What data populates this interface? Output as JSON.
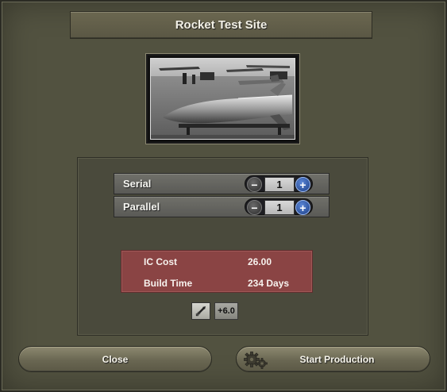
{
  "window": {
    "title": "Rocket Test Site"
  },
  "image": {
    "subject": "rocket-test-site-photo"
  },
  "production": {
    "rows": [
      {
        "label": "Serial",
        "value": "1"
      },
      {
        "label": "Parallel",
        "value": "1"
      }
    ],
    "minus_symbol": "−",
    "plus_symbol": "+"
  },
  "cost": {
    "ic_cost_label": "IC Cost",
    "ic_cost_value": "26.00",
    "build_time_label": "Build Time",
    "build_time_value": "234 Days"
  },
  "modifiers": {
    "tech_icon": "rocket-icon",
    "bonus": "+6.0"
  },
  "buttons": {
    "close": "Close",
    "start": "Start Production"
  },
  "colors": {
    "background": "#525240",
    "cost_box": "#8a4444",
    "plus_button": "#2f5fb4"
  }
}
